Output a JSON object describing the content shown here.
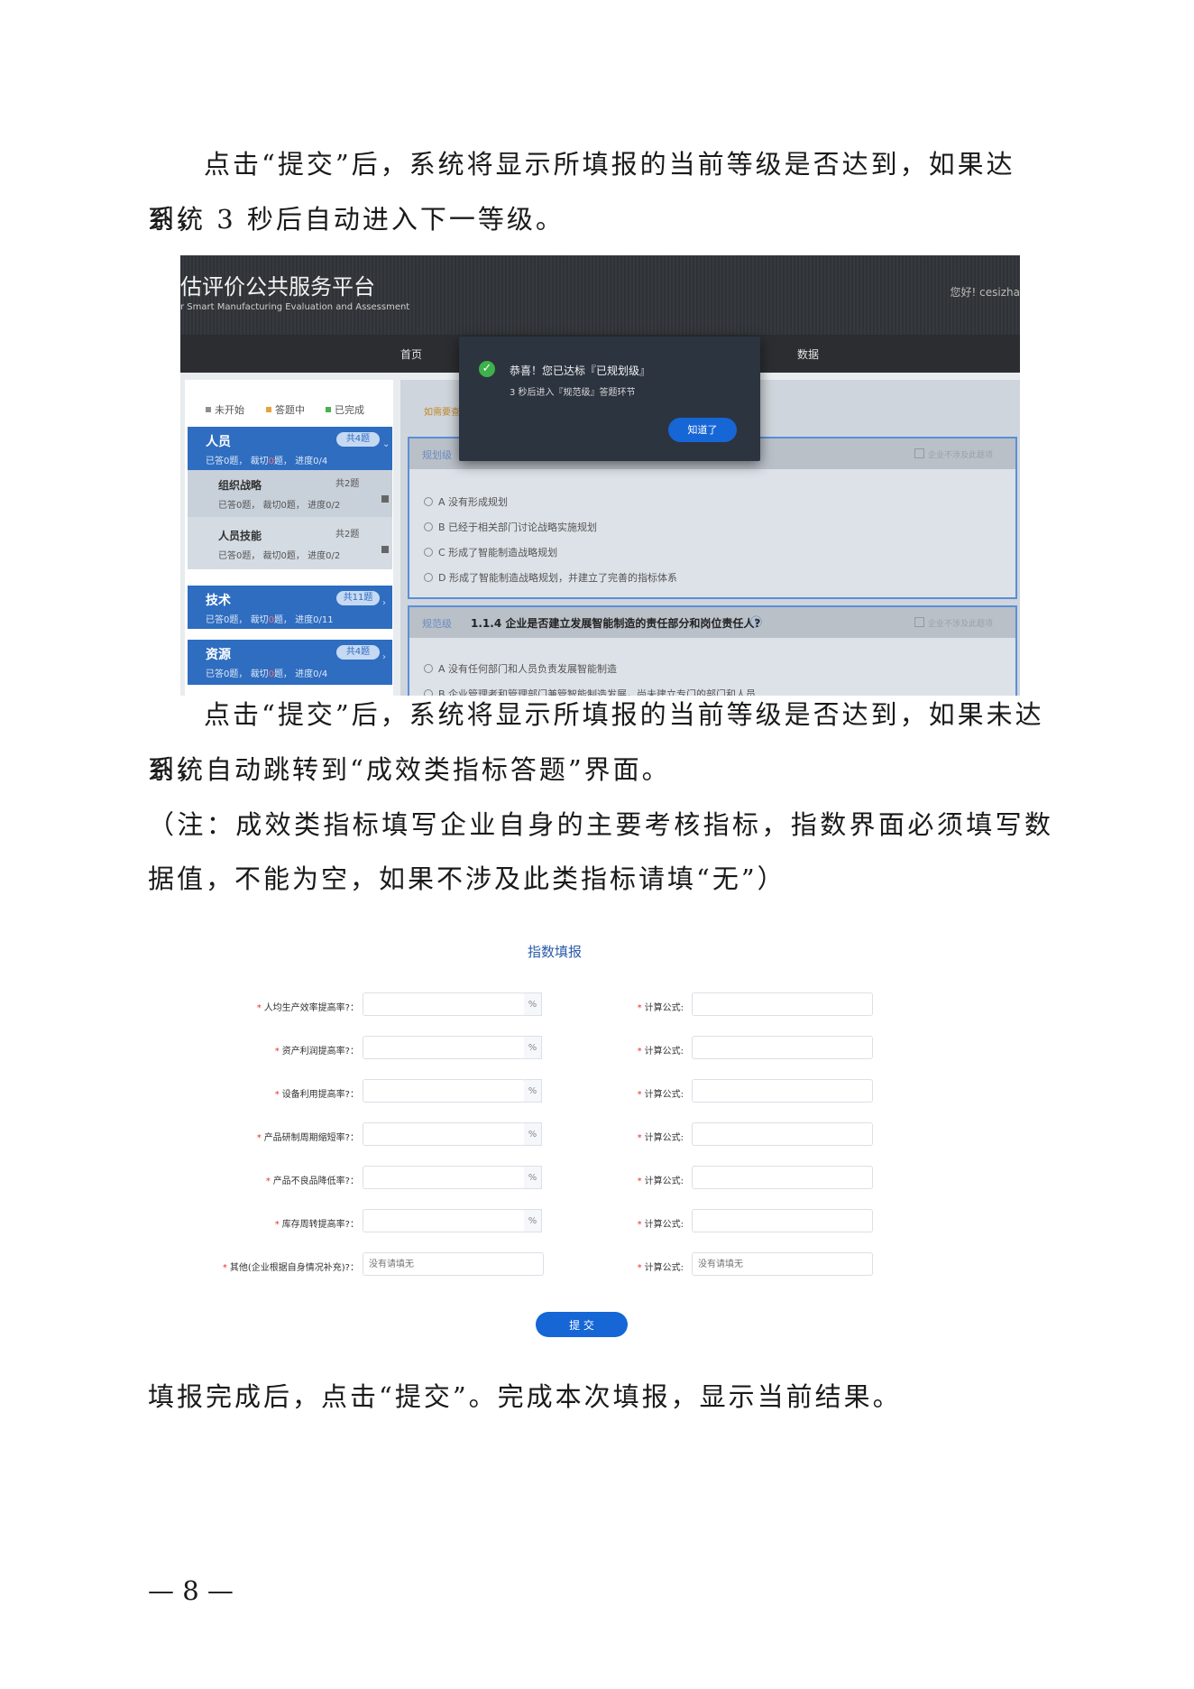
{
  "doc": {
    "p1_line1": "点击“提交”后，系统将显示所填报的当前等级是否达到，如果达到，",
    "p1_line2": "系统 3 秒后自动进入下一等级。",
    "p2_line1": "点击“提交”后，系统将显示所填报的当前等级是否达到，如果未达到，",
    "p2_line2": "系统自动跳转到“成效类指标答题”界面。",
    "p3_line1": "（注：成效类指标填写企业自身的主要考核指标，指数界面必须填写数",
    "p3_line2": "据值，不能为空，如果不涉及此类指标请填“无”）",
    "p4": "填报完成后，点击“提交”。完成本次填报，显示当前结果。",
    "page_number": "— 8 —"
  },
  "shot1": {
    "header": {
      "title": "估评价公共服务平台",
      "subtitle": "r Smart Manufacturing Evaluation and Assessment",
      "greeting": "您好! cesizha"
    },
    "nav": [
      "首页",
      "数据"
    ],
    "legend": [
      {
        "label": "未开始",
        "color": "#8a8f96"
      },
      {
        "label": "答题中",
        "color": "#e6a23c"
      },
      {
        "label": "已完成",
        "color": "#4caf50"
      }
    ],
    "categories": [
      {
        "name": "人员",
        "badge": "共4题",
        "meta_a": "已答0题，",
        "meta_b": "裁切",
        "meta_c": "0",
        "meta_d": "题，",
        "meta_e": "进度0/4"
      },
      {
        "name": "技术",
        "badge": "共11题",
        "meta_a": "已答0题，",
        "meta_b": "裁切",
        "meta_c": "0",
        "meta_d": "题，",
        "meta_e": "进度0/11"
      },
      {
        "name": "资源",
        "badge": "共4题",
        "meta_a": "已答0题，",
        "meta_b": "裁切",
        "meta_c": "0",
        "meta_d": "题，",
        "meta_e": "进度0/4"
      }
    ],
    "subcategories": [
      {
        "name": "组织战略",
        "badge": "共2题",
        "meta": "已答0题，  裁切0题，  进度0/2"
      },
      {
        "name": "人员技能",
        "badge": "共2题",
        "meta": "已答0题，  裁切0题，  进度0/2"
      }
    ],
    "hint": "如需要查",
    "question1": {
      "level": "规划级",
      "right": "企业不涉及此题项",
      "options": [
        "A  没有形成规划",
        "B  已经于相关部门讨论战略实施规划",
        "C  形成了智能制造战略规划",
        "D  形成了智能制造战略规划，并建立了完善的指标体系"
      ]
    },
    "question2": {
      "level": "规范级",
      "title": "1.1.4 企业是否建立发展智能制造的责任部分和岗位责任人?",
      "right": "企业不涉及此题项",
      "options": [
        "A  没有任何部门和人员负责发展智能制造",
        "B  企业管理者和管理部门兼管智能制造发展，尚未建立专门的部门和人员"
      ]
    },
    "modal": {
      "title": "恭喜！您已达标『已规划级』",
      "text": "3 秒后进入『规范级』答题环节",
      "button": "知道了"
    }
  },
  "shot2": {
    "title": "指数填报",
    "rows": [
      {
        "label": "人均生产效率提高率?：",
        "unit": "%",
        "formula_label": "计算公式:"
      },
      {
        "label": "资产利润提高率?：",
        "unit": "%",
        "formula_label": "计算公式:"
      },
      {
        "label": "设备利用提高率?：",
        "unit": "%",
        "formula_label": "计算公式:"
      },
      {
        "label": "产品研制周期缩短率?：",
        "unit": "%",
        "formula_label": "计算公式:"
      },
      {
        "label": "产品不良品降低率?：",
        "unit": "%",
        "formula_label": "计算公式:"
      },
      {
        "label": "库存周转提高率?：",
        "unit": "%",
        "formula_label": "计算公式:"
      }
    ],
    "other_row": {
      "label": "其他(企业根据自身情况补充)?：",
      "placeholder": "没有请填无",
      "formula_label": "计算公式:",
      "formula_placeholder": "没有请填无"
    },
    "submit": "提 交"
  }
}
